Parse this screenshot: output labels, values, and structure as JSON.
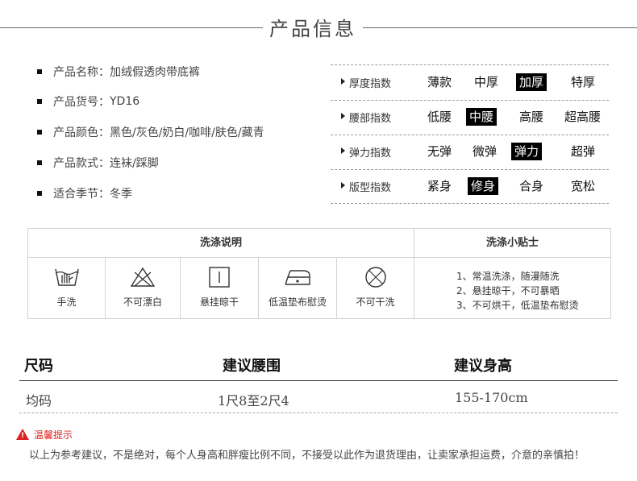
{
  "header": {
    "title": "产品信息"
  },
  "info": [
    {
      "label": "产品名称：",
      "value": "加绒假透肉带底裤"
    },
    {
      "label": "产品货号：",
      "value": "YD16"
    },
    {
      "label": "产品颜色：",
      "value": "黑色/灰色/奶白/咖啡/肤色/藏青"
    },
    {
      "label": "产品款式：",
      "value": "连袜/踩脚"
    },
    {
      "label": "适合季节：",
      "value": "冬季"
    }
  ],
  "indexes": [
    {
      "label": "厚度指数",
      "options": [
        "薄款",
        "中厚",
        "加厚",
        "特厚"
      ],
      "selected": 2
    },
    {
      "label": "腰部指数",
      "options": [
        "低腰",
        "中腰",
        "高腰",
        "超高腰"
      ],
      "selected": 1
    },
    {
      "label": "弹力指数",
      "options": [
        "无弹",
        "微弹",
        "弹力",
        "超弹"
      ],
      "selected": 2
    },
    {
      "label": "版型指数",
      "options": [
        "紧身",
        "修身",
        "合身",
        "宽松"
      ],
      "selected": 1
    }
  ],
  "wash": {
    "title": "洗涤说明",
    "tips_title": "洗涤小贴士",
    "items": [
      {
        "icon": "hand-wash-icon",
        "label": "手洗"
      },
      {
        "icon": "no-bleach-icon",
        "label": "不可漂白"
      },
      {
        "icon": "hang-dry-icon",
        "label": "悬挂晾干"
      },
      {
        "icon": "low-iron-icon",
        "label": "低温垫布慰烫"
      },
      {
        "icon": "no-dry-clean-icon",
        "label": "不可干洗"
      }
    ],
    "tips": [
      "1、常温洗涤，随漫随洗",
      "2、悬挂晾干，不可暴晒",
      "3、不可烘干，低温垫布慰烫"
    ]
  },
  "size_table": {
    "headers": [
      "尺码",
      "建议腰围",
      "建议身高"
    ],
    "rows": [
      [
        "均码",
        "1尺8至2尺4",
        "155-170cm"
      ]
    ]
  },
  "notice": {
    "title": "温馨提示",
    "text": "以上为参考建议，不是绝对，每个人身高和胖瘦比例不同，不接受以此作为退货理由，让卖家承担运费，介意的亲慎拍！"
  },
  "colors": {
    "accent": "#dd2222",
    "selected_bg": "#000000"
  }
}
